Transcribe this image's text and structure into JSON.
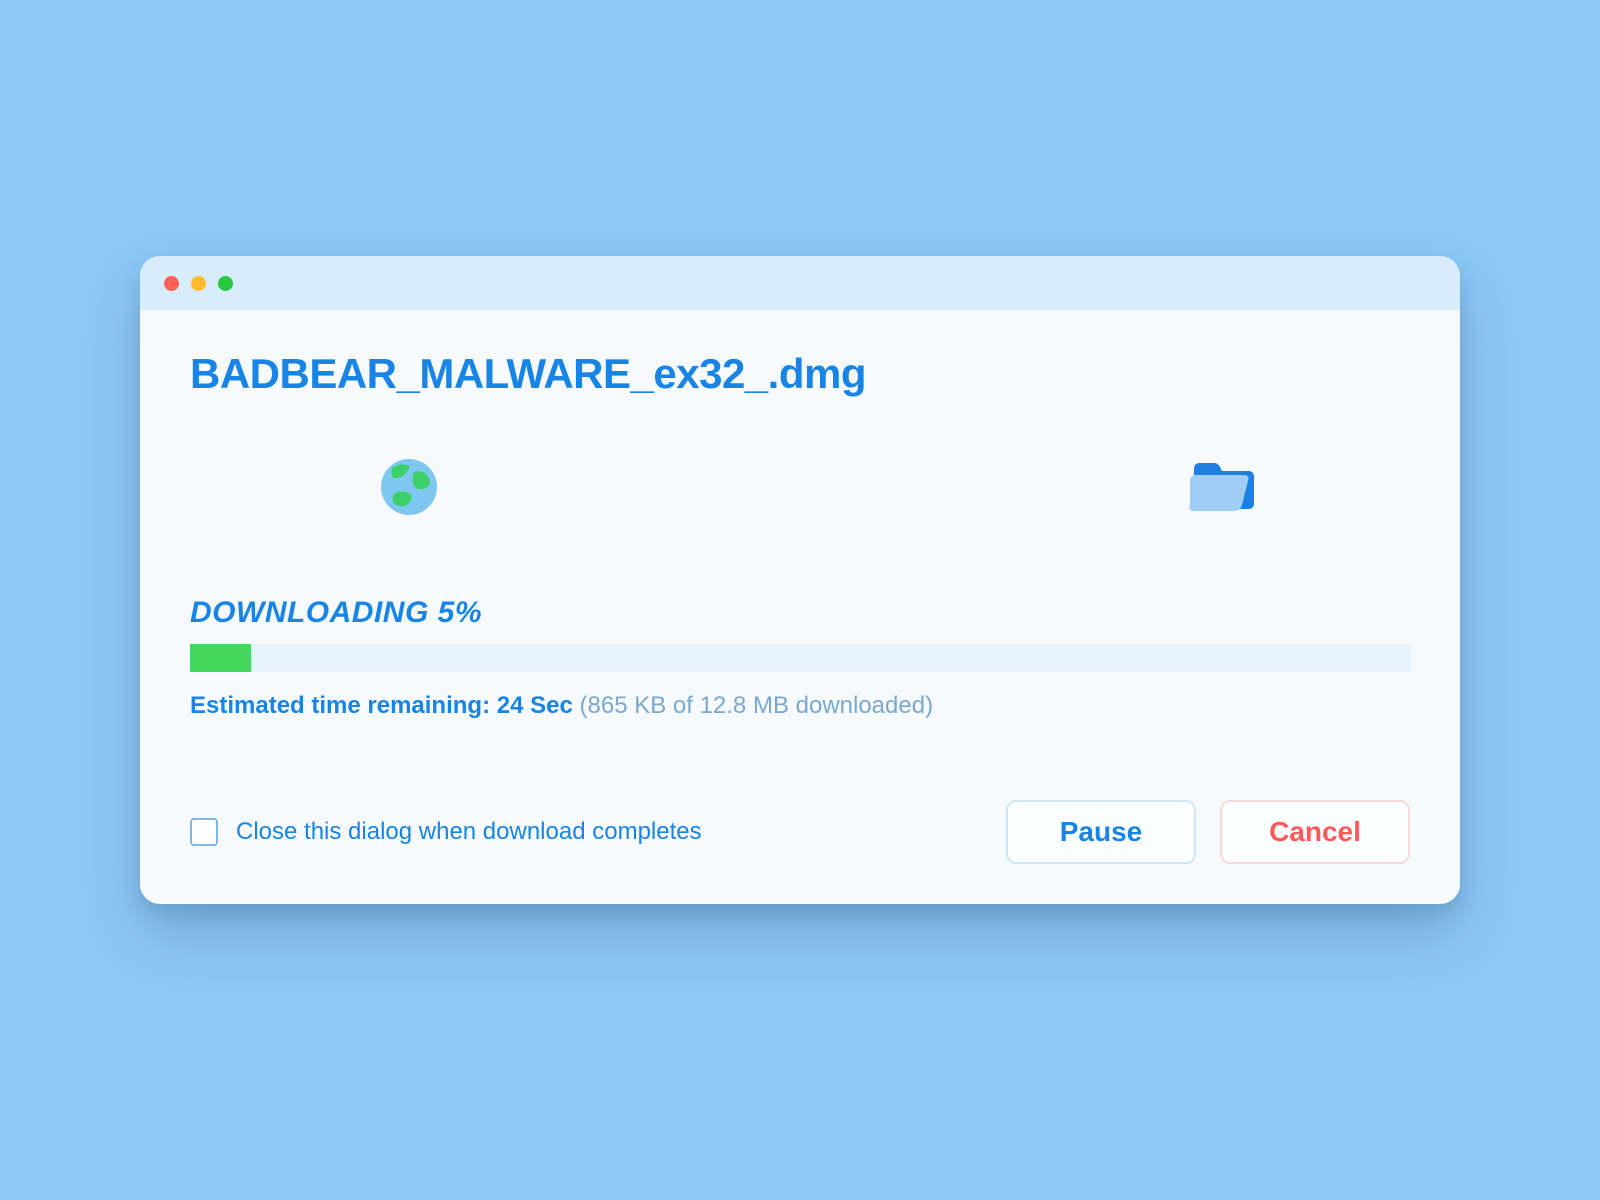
{
  "file": {
    "name": "BADBEAR_MALWARE_ex32_.dmg"
  },
  "progress": {
    "status_prefix": "DOWNLOADING",
    "percent_display": "5%",
    "percent_value": 5,
    "estimate_prefix": "Estimated time remaining:",
    "estimate_time": "24 Sec",
    "downloaded_display": "(865 KB of 12.8 MB downloaded)"
  },
  "options": {
    "close_on_complete_label": "Close this dialog when download completes",
    "close_on_complete_checked": false
  },
  "buttons": {
    "pause_label": "Pause",
    "cancel_label": "Cancel"
  },
  "colors": {
    "accent": "#1784e6",
    "progress_fill": "#45d95c",
    "danger": "#ff5a5a",
    "background": "#8cc9f7"
  }
}
